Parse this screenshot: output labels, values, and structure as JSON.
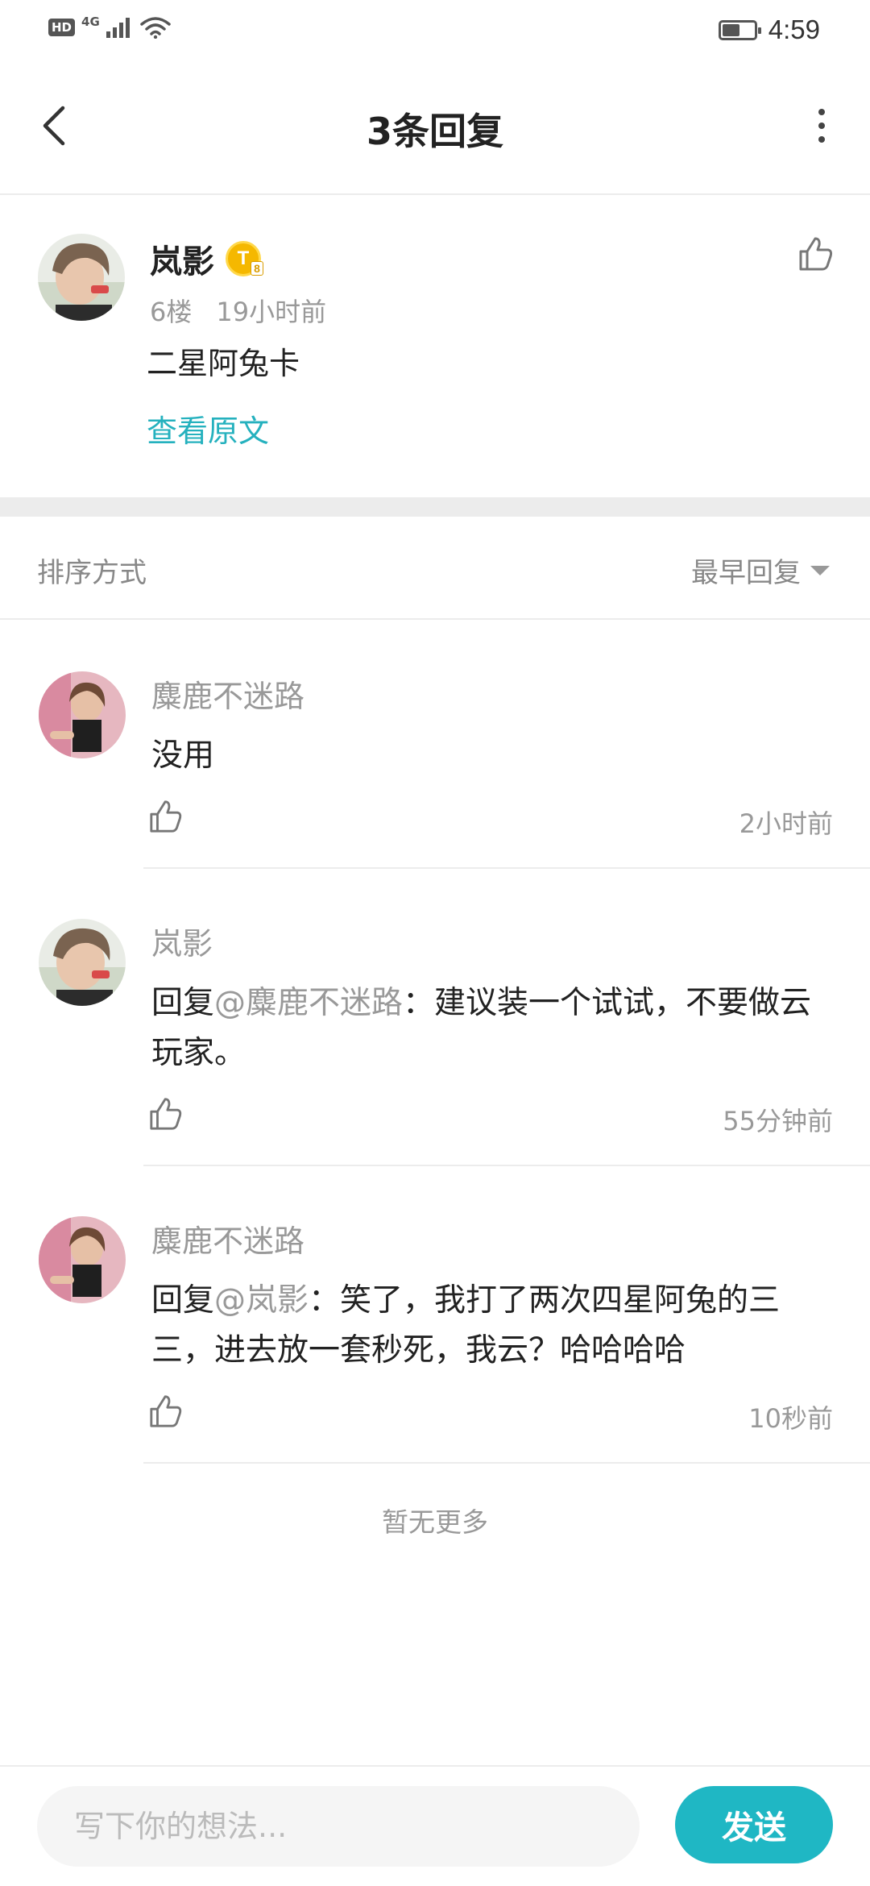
{
  "status_bar": {
    "left_badge": "HD",
    "network": "4G",
    "time": "4:59",
    "battery_level": 0.55,
    "icons": [
      "signal-icon",
      "wifi-icon",
      "battery-icon"
    ]
  },
  "nav": {
    "title": "3条回复",
    "icons": [
      "back-arrow-icon",
      "more-vertical-icon"
    ]
  },
  "post": {
    "author": "岚影",
    "badge_letter": "T",
    "badge_sub": "8",
    "floor": "6楼",
    "time": "19小时前",
    "text": "二星阿兔卡",
    "view_original": "查看原文",
    "like_icon": "thumbs-up-icon"
  },
  "sort": {
    "label": "排序方式",
    "selected": "最早回复"
  },
  "replies": [
    {
      "author": "麋鹿不迷路",
      "prefix": "",
      "mention": "",
      "text": "没用",
      "time": "2小时前"
    },
    {
      "author": "岚影",
      "prefix": "回复",
      "mention": "@麋鹿不迷路",
      "text": "：建议装一个试试，不要做云玩家。",
      "time": "55分钟前"
    },
    {
      "author": "麋鹿不迷路",
      "prefix": "回复",
      "mention": "@岚影",
      "text": "：笑了，我打了两次四星阿兔的三三，进去放一套秒死，我云？哈哈哈哈",
      "time": "10秒前"
    }
  ],
  "footer_note": "暂无更多",
  "composer": {
    "placeholder": "写下你的想法...",
    "send_label": "发送"
  },
  "colors": {
    "accent": "#1fb7c4",
    "link": "#25b1be",
    "badge_gold": "#f5b800",
    "muted_text": "#999999",
    "divider": "#ececec"
  }
}
